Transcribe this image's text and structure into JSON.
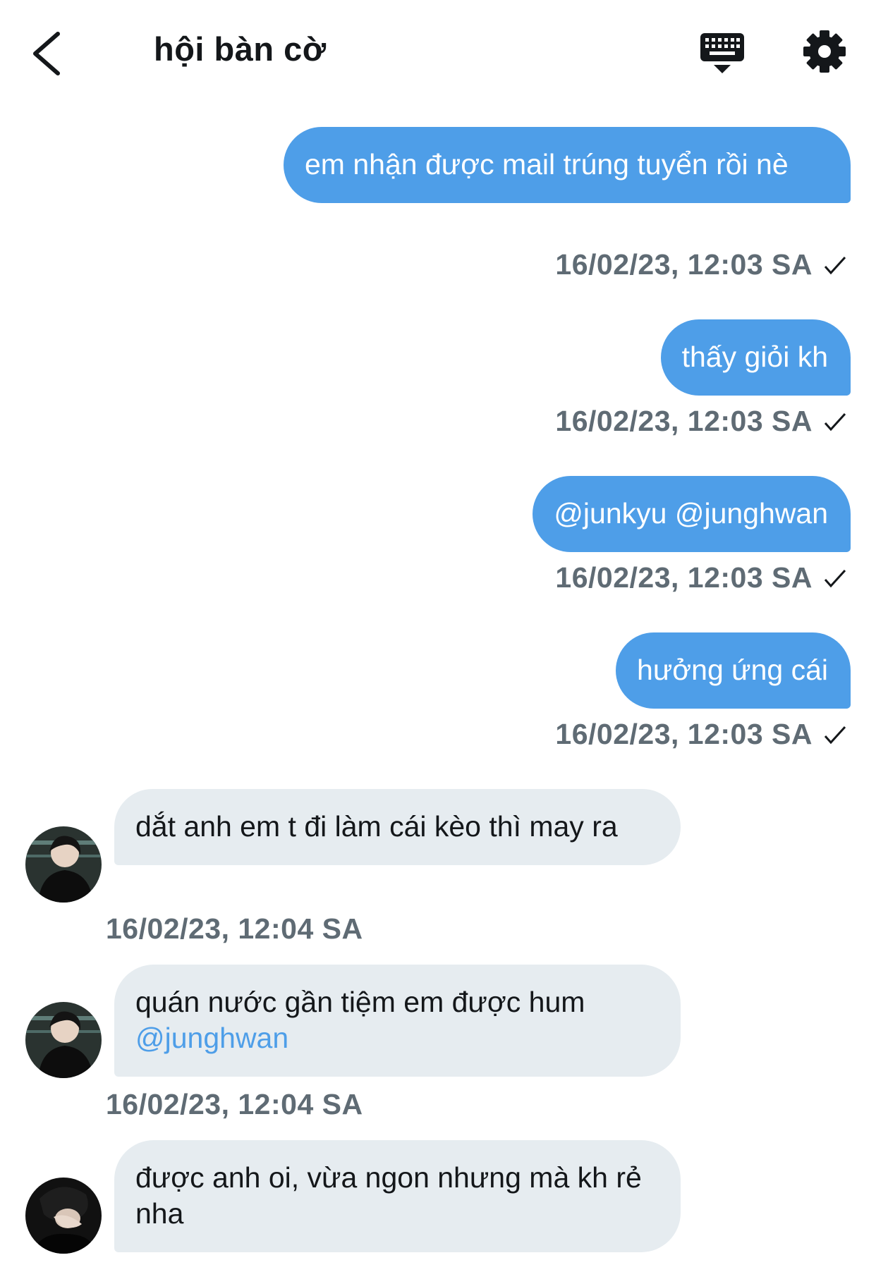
{
  "header": {
    "title": "hội bàn cờ",
    "icons": [
      "chevron-left-icon",
      "keyboard-icon",
      "gear-icon"
    ]
  },
  "colors": {
    "outgoing_bubble": "#4e9ee8",
    "incoming_bubble": "#e6ecf0",
    "mention": "#4e9ee8",
    "timestamp": "#5f6b74"
  },
  "messages": [
    {
      "direction": "outgoing",
      "text": "em nhận được mail trúng tuyển rồi nè",
      "timestamp": "16/02/23, 12:03 SA",
      "status": "sent"
    },
    {
      "direction": "outgoing",
      "text": "thấy giỏi kh",
      "timestamp": "16/02/23, 12:03 SA",
      "status": "sent"
    },
    {
      "direction": "outgoing",
      "text": "@junkyu @junghwan",
      "timestamp": "16/02/23, 12:03 SA",
      "status": "sent"
    },
    {
      "direction": "outgoing",
      "text": "hưởng ứng cái",
      "timestamp": "16/02/23, 12:03 SA",
      "status": "sent"
    },
    {
      "direction": "incoming",
      "text": "dắt anh em t đi làm cái kèo thì may ra",
      "timestamp": "16/02/23, 12:04 SA"
    },
    {
      "direction": "incoming",
      "text": "quán nước gần tiệm em được hum",
      "mention": "@junghwan",
      "timestamp": "16/02/23, 12:04 SA"
    },
    {
      "direction": "incoming",
      "text": "được anh oi, vừa ngon nhưng mà kh rẻ nha"
    }
  ]
}
